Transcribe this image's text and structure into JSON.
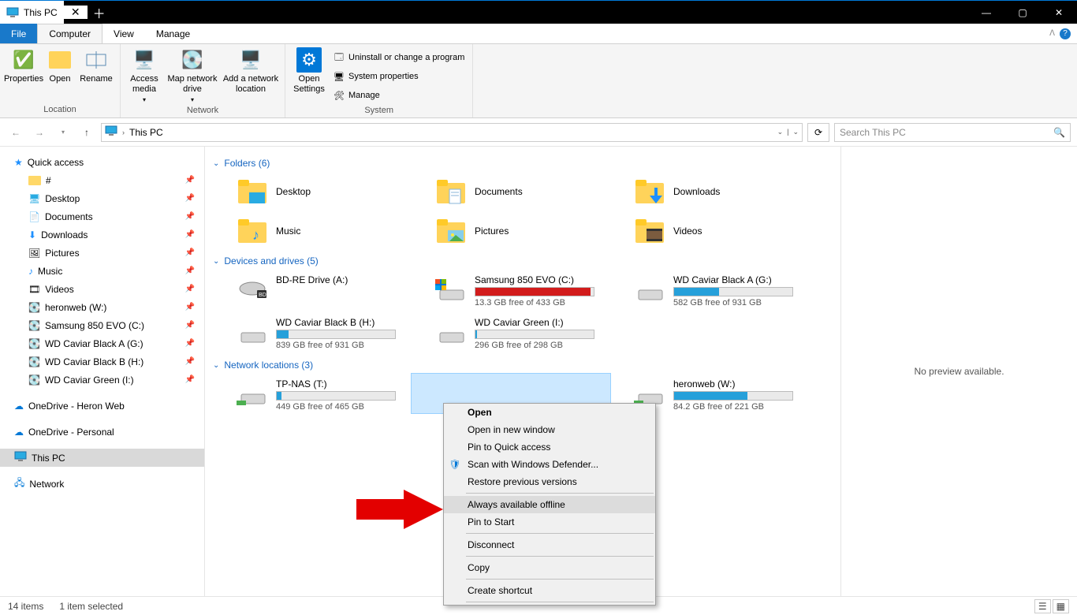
{
  "title": "This PC",
  "ribbon": {
    "tabs": {
      "file": "File",
      "computer": "Computer",
      "view": "View",
      "manage": "Manage"
    },
    "location": {
      "properties": "Properties",
      "open": "Open",
      "rename": "Rename",
      "label": "Location"
    },
    "network": {
      "access_media": "Access media",
      "map_drive": "Map network drive",
      "add_location": "Add a network location",
      "label": "Network"
    },
    "settings": {
      "open_settings": "Open Settings"
    },
    "system": {
      "uninstall": "Uninstall or change a program",
      "properties": "System properties",
      "manage": "Manage",
      "label": "System"
    }
  },
  "nav": {
    "address": "This PC",
    "search_placeholder": "Search This PC"
  },
  "sidebar": {
    "quick_access": "Quick access",
    "items": [
      {
        "label": "#"
      },
      {
        "label": "Desktop"
      },
      {
        "label": "Documents"
      },
      {
        "label": "Downloads"
      },
      {
        "label": "Pictures"
      },
      {
        "label": "Music"
      },
      {
        "label": "Videos"
      },
      {
        "label": "heronweb (W:)"
      },
      {
        "label": "Samsung 850 EVO (C:)"
      },
      {
        "label": "WD Caviar Black A (G:)"
      },
      {
        "label": "WD Caviar Black B (H:)"
      },
      {
        "label": "WD Caviar Green (I:)"
      }
    ],
    "onedrive_heron": "OneDrive - Heron Web",
    "onedrive_personal": "OneDrive - Personal",
    "this_pc": "This PC",
    "network": "Network"
  },
  "sections": {
    "folders": {
      "title": "Folders (6)",
      "items": [
        "Desktop",
        "Documents",
        "Downloads",
        "Music",
        "Pictures",
        "Videos"
      ]
    },
    "drives": {
      "title": "Devices and drives (5)",
      "items": [
        {
          "name": "BD-RE Drive (A:)",
          "free": "",
          "fill": 0,
          "color": ""
        },
        {
          "name": "Samsung 850 EVO (C:)",
          "free": "13.3 GB free of 433 GB",
          "fill": 97,
          "color": "#d21c1c"
        },
        {
          "name": "WD Caviar Black A (G:)",
          "free": "582 GB free of 931 GB",
          "fill": 38,
          "color": "#26a0da"
        },
        {
          "name": "WD Caviar Black B (H:)",
          "free": "839 GB free of 931 GB",
          "fill": 10,
          "color": "#26a0da"
        },
        {
          "name": "WD Caviar Green (I:)",
          "free": "296 GB free of 298 GB",
          "fill": 1,
          "color": "#26a0da"
        }
      ]
    },
    "network": {
      "title": "Network locations (3)",
      "items": [
        {
          "name": "TP-NAS (T:)",
          "free": "449 GB free of 465 GB",
          "fill": 4,
          "color": "#26a0da"
        },
        {
          "name": "",
          "free": "",
          "fill": 0,
          "color": "",
          "selected": true
        },
        {
          "name": "heronweb (W:)",
          "free": "84.2 GB free of 221 GB",
          "fill": 62,
          "color": "#26a0da"
        }
      ]
    }
  },
  "context_menu": {
    "open": "Open",
    "open_new": "Open in new window",
    "pin_qa": "Pin to Quick access",
    "defender": "Scan with Windows Defender...",
    "restore": "Restore previous versions",
    "always_offline": "Always available offline",
    "pin_start": "Pin to Start",
    "disconnect": "Disconnect",
    "copy": "Copy",
    "shortcut": "Create shortcut"
  },
  "preview": {
    "none": "No preview available."
  },
  "status": {
    "items": "14 items",
    "selected": "1 item selected"
  }
}
